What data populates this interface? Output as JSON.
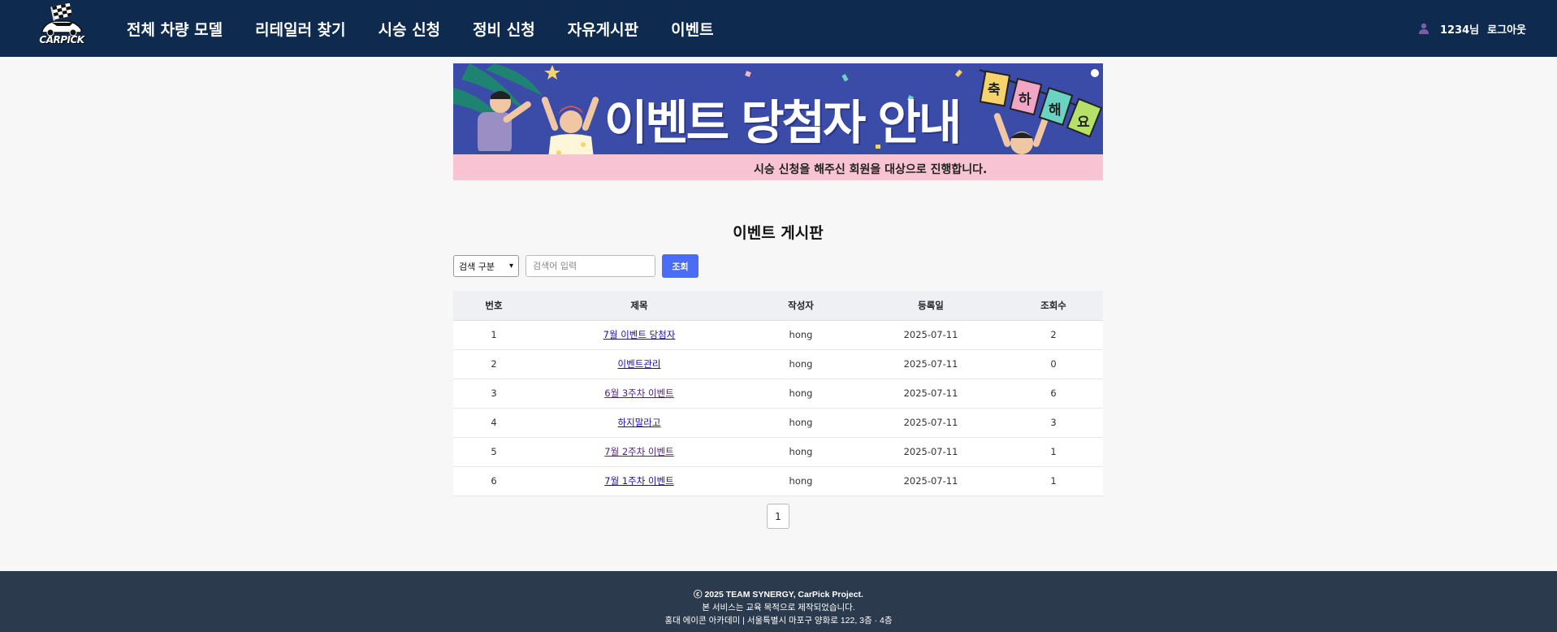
{
  "header": {
    "logo_text": "CARPICK",
    "nav": [
      "전체 차량 모델",
      "리테일러 찾기",
      "시승 신청",
      "정비 신청",
      "자유게시판",
      "이벤트"
    ],
    "user_name": "1234님",
    "logout_label": "로그아웃"
  },
  "banner": {
    "headline": "이벤트 당첨자 안내",
    "flag_letters": [
      "축",
      "하",
      "해",
      "요"
    ],
    "subtitle": "시승 신청을 해주신 회원을 대상으로 진행합니다."
  },
  "board": {
    "title": "이벤트 게시판",
    "search": {
      "select_label": "검색 구분",
      "placeholder": "검색어 입력",
      "button_label": "조회"
    },
    "columns": [
      "번호",
      "제목",
      "작성자",
      "등록일",
      "조회수"
    ],
    "rows": [
      {
        "num": "1",
        "title": "7월 이벤트 당첨자",
        "writer": "hong",
        "date": "2025-07-11",
        "views": "2",
        "visited": false
      },
      {
        "num": "2",
        "title": "이벤트관리",
        "writer": "hong",
        "date": "2025-07-11",
        "views": "0",
        "visited": false
      },
      {
        "num": "3",
        "title": "6월 3주차 이벤트",
        "writer": "hong",
        "date": "2025-07-11",
        "views": "6",
        "visited": true
      },
      {
        "num": "4",
        "title": "하지말라고",
        "writer": "hong",
        "date": "2025-07-11",
        "views": "3",
        "visited": false
      },
      {
        "num": "5",
        "title": "7월 2주차 이벤트",
        "writer": "hong",
        "date": "2025-07-11",
        "views": "1",
        "visited": true
      },
      {
        "num": "6",
        "title": "7월 1주차 이벤트",
        "writer": "hong",
        "date": "2025-07-11",
        "views": "1",
        "visited": false
      }
    ],
    "page": "1"
  },
  "footer": {
    "line1": "ⓒ 2025 TEAM SYNERGY, CarPick Project.",
    "line2": "본 서비스는 교육 목적으로 제작되었습니다.",
    "line3": "홍대 에이콘 아카데미 | 서울특별시 마포구 양화로 122, 3층 · 4층"
  },
  "colors": {
    "header_bg": "#0e2a4f",
    "footer_bg": "#2b3a4d",
    "accent_button": "#4a6cf7",
    "banner_blue": "#3b4ba8",
    "banner_pink": "#f8c3d3"
  }
}
